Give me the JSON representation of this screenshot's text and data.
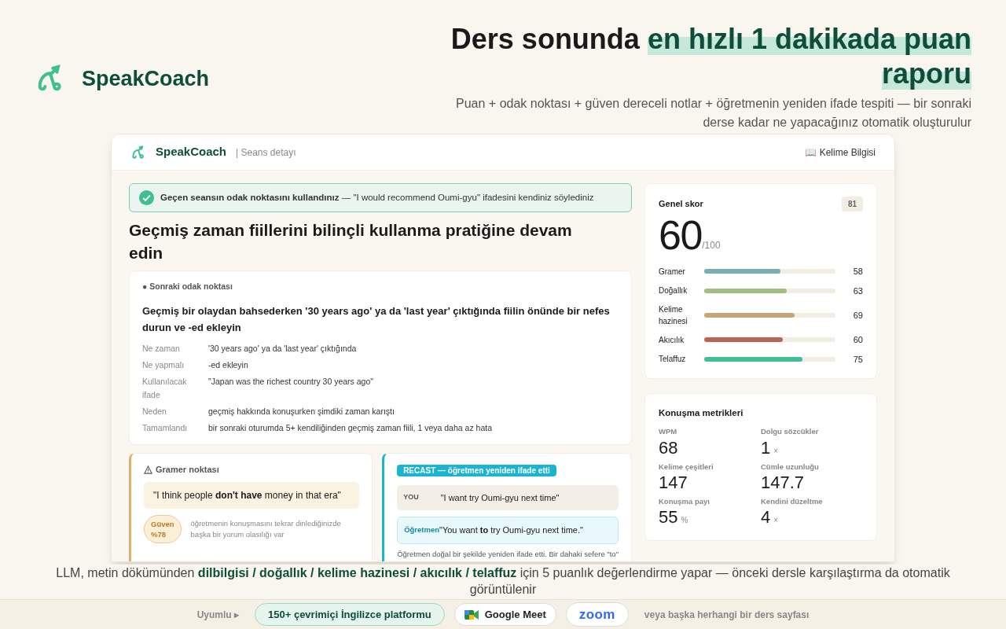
{
  "brand": {
    "name": "SpeakCoach"
  },
  "headline": "Ders sonunda **en hızlı 1 dakikada puan raporu**",
  "subtitle": "Puan + odak noktası + güven dereceli notlar + öğretmenin yeniden ifade tespiti — bir sonraki derse kadar ne yapacağınız otomatik oluşturulur",
  "app": {
    "brand": "SpeakCoach",
    "crumb": "| Seans detayı",
    "header_link": "📖 Kelime Bilgisi",
    "banner": "**Geçen seansın odak noktasını kullandınız** — \"I would recommend Oumi-gyu\" ifadesini kendiniz söylediniz",
    "title": "Geçmiş zaman fiillerini bilinçli kullanma pratiğine devam edin",
    "focus": {
      "label": "● Sonraki odak noktası",
      "heading": "Geçmiş bir olaydan bahsederken '30 years ago' ya da 'last year' çıktığında fiilin önünde bir nefes durun ve -ed ekleyin",
      "rows": [
        {
          "key": "Ne zaman",
          "value": "'30 years ago' ya da 'last year' çıktığında"
        },
        {
          "key": "Ne yapmalı",
          "value": "-ed ekleyin"
        },
        {
          "key": "Kullanılacak ifade",
          "value": "\"Japan was the richest country 30 years ago\""
        },
        {
          "key": "Neden",
          "value": "geçmiş hakkında konuşurken şimdiki zaman karıştı"
        },
        {
          "key": "Tamamlandı",
          "value": "bir sonraki oturumda 5+ kendiliğinden geçmiş zaman fiili, 1 veya daha az hata"
        }
      ]
    },
    "grammar": {
      "title": "Gramer noktası",
      "quote": "\"I think people **don't have** money in that era\"",
      "confidence": "Güven %78",
      "note": "öğretmenin konuşmasını tekrar dinlediğinizde başka bir yorum olasılığı var"
    },
    "recast": {
      "badge": "RECAST — öğretmen yeniden ifade etti",
      "you_label": "YOU",
      "you_text": "\"I want try Oumi-gyu next time\"",
      "teacher_label": "Öğretmen",
      "teacher_text": "\"You want **to** try Oumi-gyu next time.\"",
      "note": "Öğretmen doğal bir şekilde yeniden ifade etti. Bir dahaki sefere \"to\""
    },
    "score": {
      "title": "Genel skor",
      "badge": "81",
      "value": "60",
      "max": "/100",
      "bars": [
        {
          "label": "Gramer",
          "value": "58",
          "level": 0.58,
          "color": "#7aaeb0"
        },
        {
          "label": "Doğallık",
          "value": "63",
          "level": 0.63,
          "color": "#9fbf82"
        },
        {
          "label": "Kelime hazinesi",
          "value": "69",
          "level": 0.69,
          "color": "#c6a677"
        },
        {
          "label": "Akıcılık",
          "value": "60",
          "level": 0.6,
          "color": "#bf6253"
        },
        {
          "label": "Telaffuz",
          "value": "75",
          "level": 0.75,
          "color": "#3fbf93"
        }
      ]
    },
    "metrics": {
      "title": "Konuşma metrikleri",
      "items": [
        {
          "label": "WPM",
          "value": "68"
        },
        {
          "label": "Dolgu sözcükler",
          "value": "1",
          "unit": "×"
        },
        {
          "label": "Kelime çeşitleri",
          "value": "147"
        },
        {
          "label": "Cümle uzunluğu",
          "value": "147.7"
        },
        {
          "label": "Konuşma payı",
          "value": "55",
          "unit": "%"
        },
        {
          "label": "Kendini düzeltme",
          "value": "4",
          "unit": "×"
        }
      ]
    }
  },
  "caption": "LLM, metin dökümünden **dilbilgisi / doğallık / kelime hazinesi / akıcılık / telaffuz** için 5 puanlık değerlendirme yapar — önceki dersle karşılaştırma da otomatik görüntülenir",
  "footer": {
    "label": "Uyumlu ▸",
    "chips": [
      {
        "kind": "platforms",
        "text": "150+ çevrimiçi İngilizce platformu"
      },
      {
        "kind": "meet",
        "text": "Google Meet"
      },
      {
        "kind": "zoom",
        "text": "zoom"
      }
    ],
    "note": "veya başka herhangi bir ders sayfası"
  }
}
